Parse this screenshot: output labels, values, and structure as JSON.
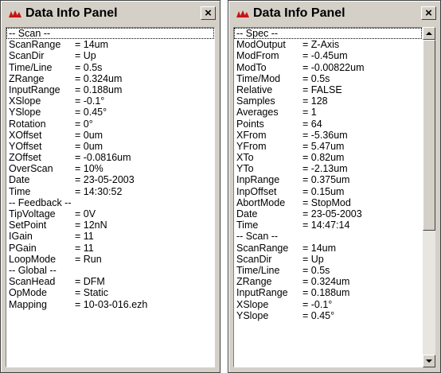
{
  "left_panel": {
    "title": "Data Info Panel",
    "close_glyph": "×",
    "rows": [
      {
        "k": "-- Scan --",
        "v": ""
      },
      {
        "k": "ScanRange",
        "v": "= 14um"
      },
      {
        "k": "ScanDir",
        "v": "= Up"
      },
      {
        "k": "Time/Line",
        "v": "= 0.5s"
      },
      {
        "k": "ZRange",
        "v": "= 0.324um"
      },
      {
        "k": "InputRange",
        "v": "= 0.188um"
      },
      {
        "k": "XSlope",
        "v": "= -0.1°"
      },
      {
        "k": "YSlope",
        "v": "= 0.45°"
      },
      {
        "k": "Rotation",
        "v": "= 0°"
      },
      {
        "k": "XOffset",
        "v": "= 0um"
      },
      {
        "k": "YOffset",
        "v": "= 0um"
      },
      {
        "k": "ZOffset",
        "v": "= -0.0816um"
      },
      {
        "k": "OverScan",
        "v": "= 10%"
      },
      {
        "k": "Date",
        "v": "= 23-05-2003"
      },
      {
        "k": "Time",
        "v": "= 14:30:52"
      },
      {
        "k": "-- Feedback --",
        "v": ""
      },
      {
        "k": "TipVoltage",
        "v": "= 0V"
      },
      {
        "k": "SetPoint",
        "v": "= 12nN"
      },
      {
        "k": "IGain",
        "v": "= 11"
      },
      {
        "k": "PGain",
        "v": "= 11"
      },
      {
        "k": "LoopMode",
        "v": "= Run"
      },
      {
        "k": "-- Global --",
        "v": ""
      },
      {
        "k": "ScanHead",
        "v": "= DFM"
      },
      {
        "k": "OpMode",
        "v": "= Static"
      },
      {
        "k": "Mapping",
        "v": "= 10-03-016.ezh"
      }
    ]
  },
  "right_panel": {
    "title": "Data Info Panel",
    "close_glyph": "×",
    "rows": [
      {
        "k": "-- Spec --",
        "v": ""
      },
      {
        "k": "ModOutput",
        "v": "= Z-Axis"
      },
      {
        "k": "ModFrom",
        "v": "= -0.45um"
      },
      {
        "k": "ModTo",
        "v": "= -0.00822um"
      },
      {
        "k": "Time/Mod",
        "v": "= 0.5s"
      },
      {
        "k": "Relative",
        "v": "= FALSE"
      },
      {
        "k": "Samples",
        "v": "= 128"
      },
      {
        "k": "Averages",
        "v": "= 1"
      },
      {
        "k": "Points",
        "v": "= 64"
      },
      {
        "k": "XFrom",
        "v": "= -5.36um"
      },
      {
        "k": "YFrom",
        "v": "= 5.47um"
      },
      {
        "k": "XTo",
        "v": "= 0.82um"
      },
      {
        "k": "YTo",
        "v": "= -2.13um"
      },
      {
        "k": "InpRange",
        "v": "= 0.375um"
      },
      {
        "k": "InpOffset",
        "v": "= 0.15um"
      },
      {
        "k": "AbortMode",
        "v": "= StopMod"
      },
      {
        "k": "Date",
        "v": "= 23-05-2003"
      },
      {
        "k": "Time",
        "v": "= 14:47:14"
      },
      {
        "k": "-- Scan --",
        "v": ""
      },
      {
        "k": "ScanRange",
        "v": "= 14um"
      },
      {
        "k": "ScanDir",
        "v": "= Up"
      },
      {
        "k": "Time/Line",
        "v": "= 0.5s"
      },
      {
        "k": "ZRange",
        "v": "= 0.324um"
      },
      {
        "k": "InputRange",
        "v": "= 0.188um"
      },
      {
        "k": "XSlope",
        "v": "= -0.1°"
      },
      {
        "k": "YSlope",
        "v": "= 0.45°"
      }
    ]
  },
  "colors": {
    "window_face": "#d4d0c8",
    "list_background": "#ffffff",
    "logo_red": "#c81414"
  },
  "icons": {
    "app_logo": "app-logo-icon",
    "close": "close-icon",
    "scroll_up": "scroll-up-arrow-icon",
    "scroll_down": "scroll-down-arrow-icon"
  }
}
